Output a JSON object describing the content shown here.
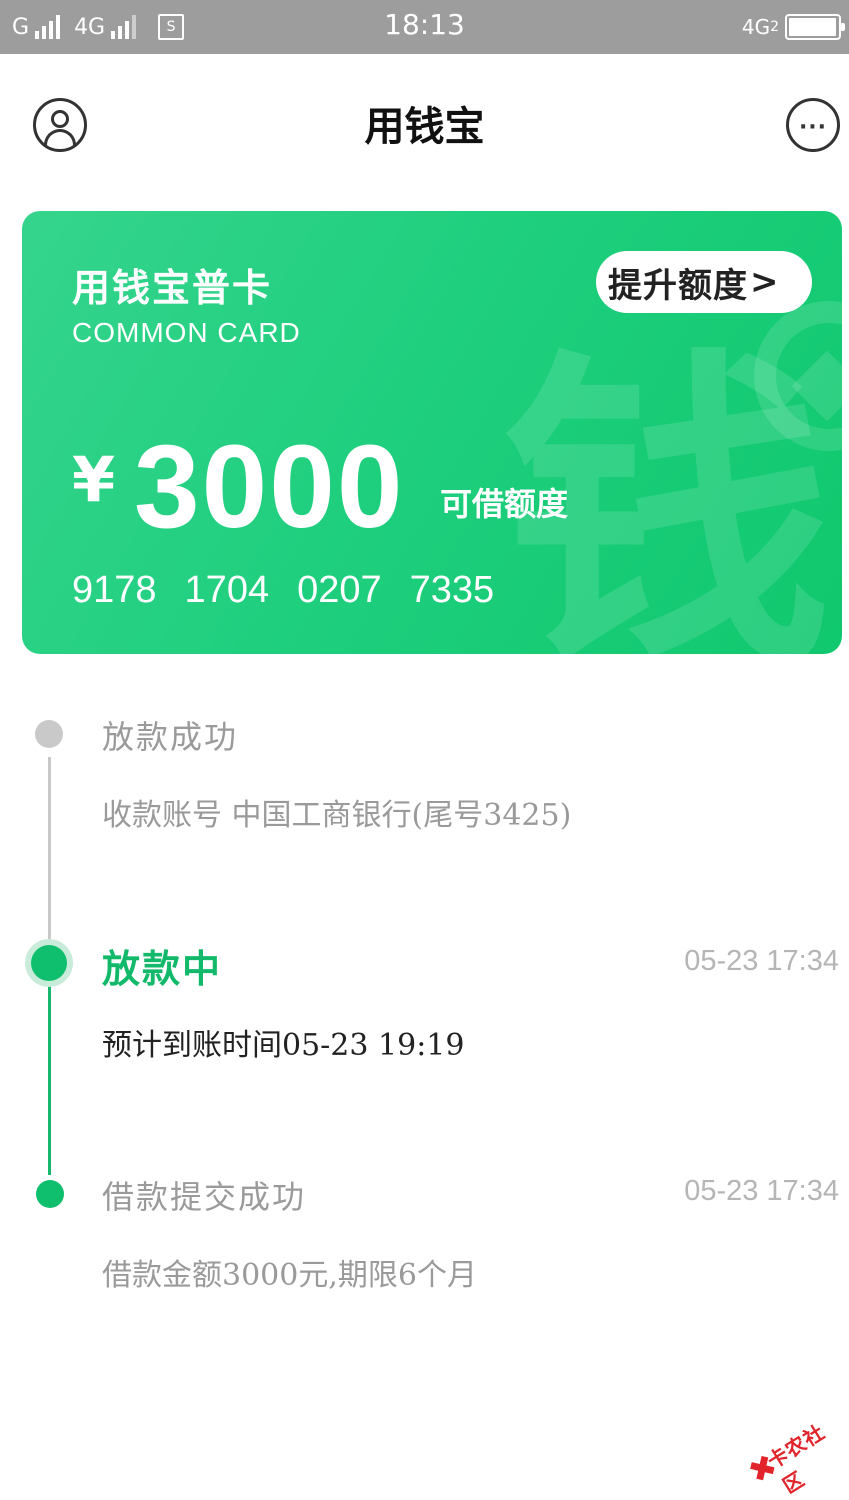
{
  "status_bar": {
    "carrier1": "G",
    "carrier2": "4G",
    "sim_icon": "S",
    "time": "18:13",
    "right_net": "4G",
    "right_sub": "2"
  },
  "header": {
    "title": "用钱宝",
    "profile_icon": "user-circle-icon",
    "more_icon": "more-dots-icon",
    "more_glyph": "···"
  },
  "card": {
    "name": "用钱宝普卡",
    "subtitle": "COMMON CARD",
    "raise_button": "提升额度",
    "raise_chevron": ">",
    "currency": "¥",
    "amount": "3000",
    "amount_label": "可借额度",
    "number_groups": [
      "9178",
      "1704",
      "0207",
      "7335"
    ],
    "watermark_glyph": "钱",
    "colors": {
      "start": "#35d48d",
      "end": "#10c86e"
    }
  },
  "timeline": [
    {
      "title": "放款成功",
      "desc": "收款账号 中国工商银行(尾号3425)",
      "time": ""
    },
    {
      "title": "放款中",
      "desc": "预计到账时间05-23 19:19",
      "time": "05-23 17:34"
    },
    {
      "title": "借款提交成功",
      "desc": "借款金额3000元,期限6个月",
      "time": "05-23 17:34"
    }
  ],
  "watermark": {
    "text": "卡农社区"
  },
  "colors": {
    "accent": "#13b96b",
    "muted": "#9a9a9a",
    "statusbar": "#9d9d9d"
  }
}
